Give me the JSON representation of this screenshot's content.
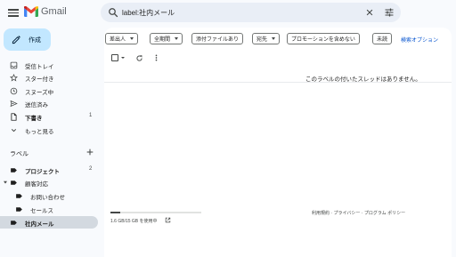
{
  "app": {
    "name": "Gmail"
  },
  "search": {
    "value": "label:社内メール"
  },
  "compose": {
    "label": "作成"
  },
  "nav": [
    {
      "label": "受信トレイ",
      "count": ""
    },
    {
      "label": "スター付き",
      "count": ""
    },
    {
      "label": "スヌーズ中",
      "count": ""
    },
    {
      "label": "送信済み",
      "count": ""
    },
    {
      "label": "下書き",
      "count": "1"
    },
    {
      "label": "もっと見る",
      "count": ""
    }
  ],
  "labels": {
    "header": "ラベル",
    "items": [
      {
        "label": "プロジェクト",
        "count": "2"
      },
      {
        "label": "顧客対応",
        "count": ""
      },
      {
        "label": "お問い合わせ",
        "count": ""
      },
      {
        "label": "セールス",
        "count": ""
      },
      {
        "label": "社内メール",
        "count": ""
      }
    ]
  },
  "filters": {
    "chips": [
      "差出人",
      "全期間",
      "添付ファイルあり",
      "宛先",
      "プロモーションを含めない",
      "未読"
    ],
    "advanced": "検索オプション"
  },
  "main": {
    "empty_message": "このラベルの付いたスレッドはありません。"
  },
  "storage": {
    "text": "1.6 GB/15 GB を使用中",
    "used_fraction": 0.107
  },
  "footer": {
    "terms": "利用規約",
    "privacy": "プライバシー",
    "program_policy": "プログラム ポリシー",
    "sep": " · "
  }
}
